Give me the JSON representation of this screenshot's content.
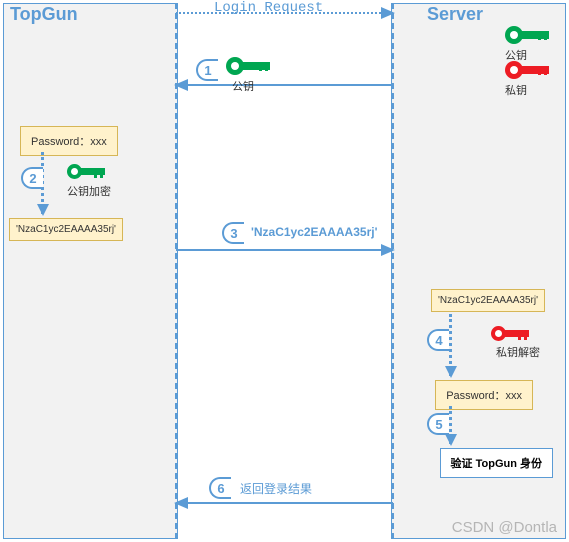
{
  "actors": {
    "client": "TopGun",
    "server": "Server"
  },
  "messages": {
    "login_request": "Login Request",
    "public_key_label": "公钥",
    "private_key_label": "私钥",
    "public_key_encrypt": "公钥加密",
    "private_key_decrypt": "私钥解密",
    "encrypted_string": "'NzaC1yc2EAAAA35rj'",
    "encrypted_quoted": "'NzaC1yc2EAAAA35rj'",
    "return_result": "返回登录结果"
  },
  "boxes": {
    "password": "Password：xxx",
    "password2": "Password：xxx",
    "verify": "验证 TopGun 身份"
  },
  "steps": {
    "s1": "1",
    "s2": "2",
    "s3": "3",
    "s4": "4",
    "s5": "5",
    "s6": "6"
  },
  "watermark": "CSDN @Dontla"
}
